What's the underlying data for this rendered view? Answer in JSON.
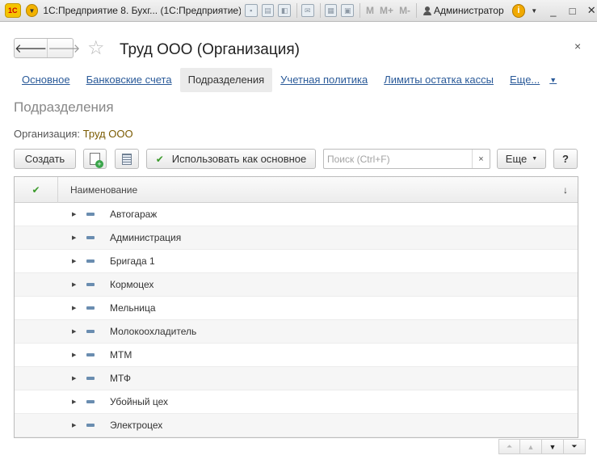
{
  "window": {
    "title": "1С:Предприятие 8. Бухг...  (1С:Предприятие)",
    "logo_text": "1С",
    "memory_buttons": [
      "M",
      "M+",
      "M-"
    ],
    "user": "Администратор",
    "controls": {
      "minimize": "_",
      "maximize": "□",
      "close": "✕"
    }
  },
  "form": {
    "title": "Труд ООО (Организация)",
    "close": "×",
    "back": "🡐",
    "forward": "🡒",
    "star": "☆"
  },
  "tabs": [
    {
      "label": "Основное",
      "active": false
    },
    {
      "label": "Банковские счета",
      "active": false
    },
    {
      "label": "Подразделения",
      "active": true
    },
    {
      "label": "Учетная политика",
      "active": false
    },
    {
      "label": "Лимиты остатка кассы",
      "active": false
    }
  ],
  "tab_more": "Еще...",
  "section": {
    "title": "Подразделения",
    "org_label": "Организация:",
    "org_value": "Труд ООО"
  },
  "toolbar": {
    "create_label": "Создать",
    "use_as_main_label": "Использовать как основное",
    "search_placeholder": "Поиск (Ctrl+F)",
    "search_value": "",
    "clear_label": "×",
    "more_label": "Еще",
    "help_label": "?"
  },
  "table": {
    "column_name": "Наименование",
    "sort_indicator": "↓",
    "rows": [
      "Автогараж",
      "Администрация",
      "Бригада 1",
      "Кормоцех",
      "Мельница",
      "Молокоохладитель",
      "МТМ",
      "МТФ",
      "Убойный цех",
      "Электроцех"
    ]
  },
  "colors": {
    "link": "#2a5a99",
    "check": "#3a9a2a",
    "org_value": "#7a5a00"
  }
}
